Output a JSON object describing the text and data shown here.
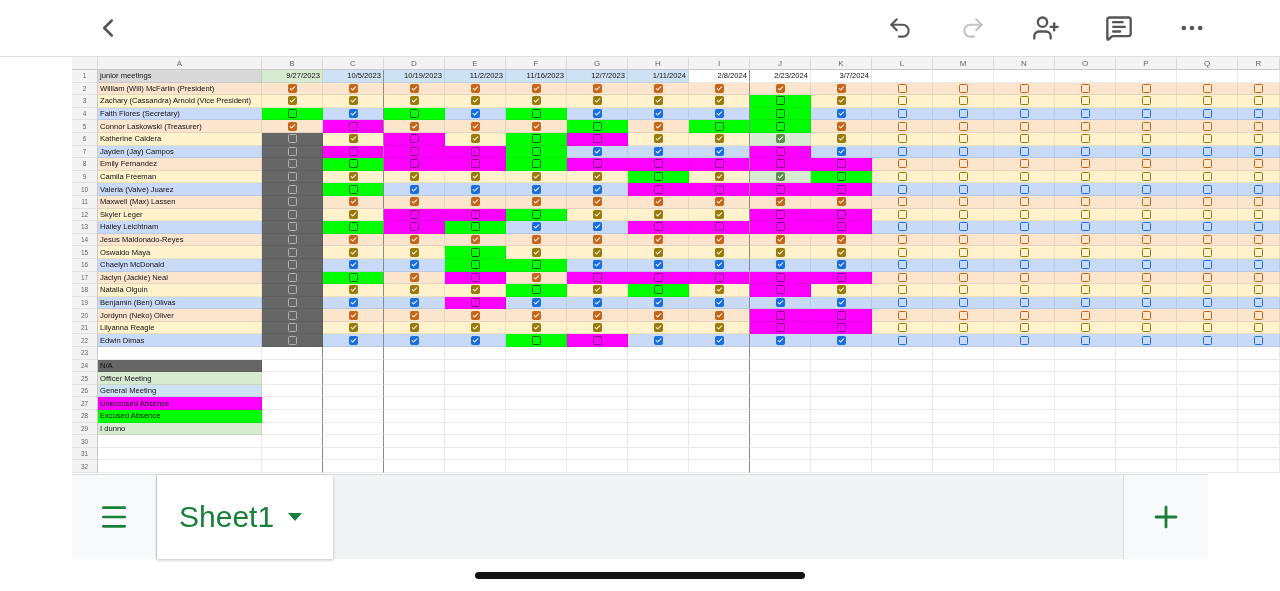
{
  "toolbar": {
    "redo": {
      "disabled": true
    }
  },
  "columns": [
    "A",
    "B",
    "C",
    "D",
    "E",
    "F",
    "G",
    "H",
    "I",
    "J",
    "K",
    "L",
    "M",
    "N",
    "O",
    "P",
    "Q",
    "R"
  ],
  "header_row": {
    "number": "1",
    "title": "junior meetings",
    "dates": [
      {
        "label": "9/27/2023",
        "color": "#d9ead3"
      },
      {
        "label": "10/5/2023",
        "color": "#cfe2f3"
      },
      {
        "label": "10/19/2023",
        "color": "#cfe2f3"
      },
      {
        "label": "11/2/2023",
        "color": "#cfe2f3"
      },
      {
        "label": "11/16/2023",
        "color": "#cfe2f3"
      },
      {
        "label": "12/7/2023",
        "color": "#cfe2f3"
      },
      {
        "label": "1/11/2024",
        "color": "#cfe2f3"
      },
      {
        "label": "2/8/2024"
      },
      {
        "label": "2/23/2024"
      },
      {
        "label": "3/7/2024"
      }
    ]
  },
  "rows": [
    {
      "number": "2",
      "name": "William (Will) McFarlin (President)",
      "cells": [
        {
          "checked": true
        },
        {
          "checked": true
        },
        {
          "checked": true
        },
        {
          "checked": true
        },
        {
          "checked": true
        },
        {
          "checked": true
        },
        {
          "checked": true
        },
        {
          "checked": true
        },
        {
          "checked": true
        },
        {
          "checked": true
        },
        {
          "checked": false
        },
        {
          "checked": false
        },
        {
          "checked": false
        },
        {
          "checked": false
        },
        {
          "checked": false
        },
        {
          "checked": false
        },
        {
          "checked": false
        }
      ]
    },
    {
      "number": "3",
      "name": "Zachary (Cassandra) Arnold (Vice President)",
      "cells": [
        {
          "checked": true
        },
        {
          "checked": true
        },
        {
          "checked": true
        },
        {
          "checked": true
        },
        {
          "checked": true
        },
        {
          "checked": true
        },
        {
          "checked": true
        },
        {
          "checked": true
        },
        {
          "checked": false,
          "color": "#00ff00"
        },
        {
          "checked": true
        },
        {
          "checked": false
        },
        {
          "checked": false
        },
        {
          "checked": false
        },
        {
          "checked": false
        },
        {
          "checked": false
        },
        {
          "checked": false
        },
        {
          "checked": false
        }
      ]
    },
    {
      "number": "4",
      "name": "Faith Flores (Secretary)",
      "cells": [
        {
          "checked": false,
          "color": "#00ff00"
        },
        {
          "checked": true
        },
        {
          "checked": false,
          "color": "#00ff00"
        },
        {
          "checked": true
        },
        {
          "checked": false,
          "color": "#00ff00"
        },
        {
          "checked": true
        },
        {
          "checked": true
        },
        {
          "checked": true
        },
        {
          "checked": false,
          "color": "#00ff00"
        },
        {
          "checked": true
        },
        {
          "checked": false
        },
        {
          "checked": false
        },
        {
          "checked": false
        },
        {
          "checked": false
        },
        {
          "checked": false
        },
        {
          "checked": false
        },
        {
          "checked": false
        }
      ]
    },
    {
      "number": "5",
      "name": "Connor Laskowski (Treasurer)",
      "cells": [
        {
          "checked": true
        },
        {
          "checked": false,
          "color": "#ff00ff"
        },
        {
          "checked": true
        },
        {
          "checked": true
        },
        {
          "checked": true
        },
        {
          "checked": false,
          "color": "#00ff00"
        },
        {
          "checked": true
        },
        {
          "checked": false,
          "color": "#00ff00"
        },
        {
          "checked": false,
          "color": "#00ff00"
        },
        {
          "checked": true
        },
        {
          "checked": false
        },
        {
          "checked": false
        },
        {
          "checked": false
        },
        {
          "checked": false
        },
        {
          "checked": false
        },
        {
          "checked": false
        },
        {
          "checked": false
        }
      ]
    },
    {
      "number": "6",
      "name": "Katherine Caldera",
      "cells": [
        {
          "checked": false,
          "color": "#666666"
        },
        {
          "checked": true
        },
        {
          "checked": false,
          "color": "#ff00ff"
        },
        {
          "checked": true
        },
        {
          "checked": false,
          "color": "#00ff00"
        },
        {
          "checked": false,
          "color": "#ff00ff"
        },
        {
          "checked": true
        },
        {
          "checked": true
        },
        {
          "checked": true,
          "color": "#d9ead3"
        },
        {
          "checked": true
        },
        {
          "checked": false
        },
        {
          "checked": false
        },
        {
          "checked": false
        },
        {
          "checked": false
        },
        {
          "checked": false
        },
        {
          "checked": false
        },
        {
          "checked": false
        }
      ]
    },
    {
      "number": "7",
      "name": "Jayden (Jay) Campos",
      "cells": [
        {
          "checked": false,
          "color": "#666666"
        },
        {
          "checked": false,
          "color": "#ff00ff"
        },
        {
          "checked": false,
          "color": "#ff00ff"
        },
        {
          "checked": false,
          "color": "#ff00ff"
        },
        {
          "checked": false,
          "color": "#00ff00"
        },
        {
          "checked": true
        },
        {
          "checked": true
        },
        {
          "checked": true
        },
        {
          "checked": false,
          "color": "#ff00ff"
        },
        {
          "checked": true
        },
        {
          "checked": false
        },
        {
          "checked": false
        },
        {
          "checked": false
        },
        {
          "checked": false
        },
        {
          "checked": false
        },
        {
          "checked": false
        },
        {
          "checked": false
        }
      ]
    },
    {
      "number": "8",
      "name": "Emily Fernandez",
      "cells": [
        {
          "checked": false,
          "color": "#666666"
        },
        {
          "checked": false,
          "color": "#00ff00"
        },
        {
          "checked": false,
          "color": "#ff00ff"
        },
        {
          "checked": false,
          "color": "#ff00ff"
        },
        {
          "checked": false,
          "color": "#00ff00"
        },
        {
          "checked": false,
          "color": "#ff00ff"
        },
        {
          "checked": false,
          "color": "#ff00ff"
        },
        {
          "checked": false,
          "color": "#ff00ff"
        },
        {
          "checked": false,
          "color": "#ff00ff"
        },
        {
          "checked": false,
          "color": "#ff00ff"
        },
        {
          "checked": false
        },
        {
          "checked": false
        },
        {
          "checked": false
        },
        {
          "checked": false
        },
        {
          "checked": false
        },
        {
          "checked": false
        },
        {
          "checked": false
        }
      ]
    },
    {
      "number": "9",
      "name": "Camila Freeman",
      "cells": [
        {
          "checked": false,
          "color": "#666666"
        },
        {
          "checked": true
        },
        {
          "checked": true
        },
        {
          "checked": true
        },
        {
          "checked": true
        },
        {
          "checked": true
        },
        {
          "checked": false,
          "color": "#00ff00"
        },
        {
          "checked": true
        },
        {
          "checked": true,
          "color": "#d9ead3"
        },
        {
          "checked": false,
          "color": "#00ff00"
        },
        {
          "checked": false
        },
        {
          "checked": false
        },
        {
          "checked": false
        },
        {
          "checked": false
        },
        {
          "checked": false
        },
        {
          "checked": false
        },
        {
          "checked": false
        }
      ]
    },
    {
      "number": "10",
      "name": "Valeria (Valve) Juarez",
      "cells": [
        {
          "checked": false,
          "color": "#666666"
        },
        {
          "checked": false,
          "color": "#00ff00"
        },
        {
          "checked": true
        },
        {
          "checked": true
        },
        {
          "checked": true
        },
        {
          "checked": true
        },
        {
          "checked": false,
          "color": "#ff00ff"
        },
        {
          "checked": false,
          "color": "#ff00ff"
        },
        {
          "checked": false,
          "color": "#ff00ff"
        },
        {
          "checked": false,
          "color": "#ff00ff"
        },
        {
          "checked": false
        },
        {
          "checked": false
        },
        {
          "checked": false
        },
        {
          "checked": false
        },
        {
          "checked": false
        },
        {
          "checked": false
        },
        {
          "checked": false
        }
      ]
    },
    {
      "number": "11",
      "name": "Maxwell (Max) Lassen",
      "cells": [
        {
          "checked": false,
          "color": "#666666"
        },
        {
          "checked": true
        },
        {
          "checked": true
        },
        {
          "checked": true
        },
        {
          "checked": true
        },
        {
          "checked": true
        },
        {
          "checked": true
        },
        {
          "checked": true
        },
        {
          "checked": true
        },
        {
          "checked": true
        },
        {
          "checked": false
        },
        {
          "checked": false
        },
        {
          "checked": false
        },
        {
          "checked": false
        },
        {
          "checked": false
        },
        {
          "checked": false
        },
        {
          "checked": false
        }
      ]
    },
    {
      "number": "12",
      "name": "Skyler Leger",
      "cells": [
        {
          "checked": false,
          "color": "#666666"
        },
        {
          "checked": true
        },
        {
          "checked": false,
          "color": "#ff00ff"
        },
        {
          "checked": false,
          "color": "#ff00ff"
        },
        {
          "checked": false,
          "color": "#00ff00"
        },
        {
          "checked": true
        },
        {
          "checked": true
        },
        {
          "checked": true
        },
        {
          "checked": false,
          "color": "#ff00ff"
        },
        {
          "checked": false,
          "color": "#ff00ff"
        },
        {
          "checked": false
        },
        {
          "checked": false
        },
        {
          "checked": false
        },
        {
          "checked": false
        },
        {
          "checked": false
        },
        {
          "checked": false
        },
        {
          "checked": false
        }
      ]
    },
    {
      "number": "13",
      "name": "Hailey Leichtnam",
      "cells": [
        {
          "checked": false,
          "color": "#666666"
        },
        {
          "checked": false,
          "color": "#00ff00"
        },
        {
          "checked": false,
          "color": "#ff00ff"
        },
        {
          "checked": false,
          "color": "#00ff00"
        },
        {
          "checked": true
        },
        {
          "checked": true
        },
        {
          "checked": false,
          "color": "#ff00ff"
        },
        {
          "checked": false,
          "color": "#ff00ff"
        },
        {
          "checked": false,
          "color": "#ff00ff"
        },
        {
          "checked": false,
          "color": "#ff00ff"
        },
        {
          "checked": false
        },
        {
          "checked": false
        },
        {
          "checked": false
        },
        {
          "checked": false
        },
        {
          "checked": false
        },
        {
          "checked": false
        },
        {
          "checked": false
        }
      ]
    },
    {
      "number": "14",
      "name": "Jesus Maldonado-Reyes",
      "cells": [
        {
          "checked": false,
          "color": "#666666"
        },
        {
          "checked": true
        },
        {
          "checked": true
        },
        {
          "checked": true
        },
        {
          "checked": true
        },
        {
          "checked": true
        },
        {
          "checked": true
        },
        {
          "checked": true
        },
        {
          "checked": true
        },
        {
          "checked": true
        },
        {
          "checked": false
        },
        {
          "checked": false
        },
        {
          "checked": false
        },
        {
          "checked": false
        },
        {
          "checked": false
        },
        {
          "checked": false
        },
        {
          "checked": false
        }
      ]
    },
    {
      "number": "15",
      "name": "Oswaldo Maya",
      "cells": [
        {
          "checked": false,
          "color": "#666666"
        },
        {
          "checked": true
        },
        {
          "checked": true
        },
        {
          "checked": false,
          "color": "#00ff00"
        },
        {
          "checked": true
        },
        {
          "checked": true
        },
        {
          "checked": true
        },
        {
          "checked": true
        },
        {
          "checked": true
        },
        {
          "checked": true
        },
        {
          "checked": false
        },
        {
          "checked": false
        },
        {
          "checked": false
        },
        {
          "checked": false
        },
        {
          "checked": false
        },
        {
          "checked": false
        },
        {
          "checked": false
        }
      ]
    },
    {
      "number": "16",
      "name": "Chaelyn McDonald",
      "cells": [
        {
          "checked": false,
          "color": "#666666"
        },
        {
          "checked": true
        },
        {
          "checked": true
        },
        {
          "checked": false,
          "color": "#00ff00"
        },
        {
          "checked": false,
          "color": "#00ff00"
        },
        {
          "checked": true
        },
        {
          "checked": true
        },
        {
          "checked": true
        },
        {
          "checked": true
        },
        {
          "checked": true
        },
        {
          "checked": false
        },
        {
          "checked": false
        },
        {
          "checked": false
        },
        {
          "checked": false
        },
        {
          "checked": false
        },
        {
          "checked": false
        },
        {
          "checked": false
        }
      ]
    },
    {
      "number": "17",
      "name": "Jaclyn (Jackie) Neal",
      "cells": [
        {
          "checked": false,
          "color": "#666666"
        },
        {
          "checked": false,
          "color": "#00ff00"
        },
        {
          "checked": true
        },
        {
          "checked": false,
          "color": "#ff00ff"
        },
        {
          "checked": true
        },
        {
          "checked": false,
          "color": "#ff00ff"
        },
        {
          "checked": false,
          "color": "#ff00ff"
        },
        {
          "checked": false,
          "color": "#ff00ff"
        },
        {
          "checked": false,
          "color": "#ff00ff"
        },
        {
          "checked": false,
          "color": "#ff00ff"
        },
        {
          "checked": false
        },
        {
          "checked": false
        },
        {
          "checked": false
        },
        {
          "checked": false
        },
        {
          "checked": false
        },
        {
          "checked": false
        },
        {
          "checked": false
        }
      ]
    },
    {
      "number": "18",
      "name": "Natalia Olguin",
      "cells": [
        {
          "checked": false,
          "color": "#666666"
        },
        {
          "checked": true
        },
        {
          "checked": true
        },
        {
          "checked": true
        },
        {
          "checked": false,
          "color": "#00ff00"
        },
        {
          "checked": true
        },
        {
          "checked": false,
          "color": "#00ff00"
        },
        {
          "checked": true
        },
        {
          "checked": false,
          "color": "#ff00ff"
        },
        {
          "checked": true
        },
        {
          "checked": false
        },
        {
          "checked": false
        },
        {
          "checked": false
        },
        {
          "checked": false
        },
        {
          "checked": false
        },
        {
          "checked": false
        },
        {
          "checked": false
        }
      ]
    },
    {
      "number": "19",
      "name": "Benjamin (Ben) Olivas",
      "cells": [
        {
          "checked": false,
          "color": "#666666"
        },
        {
          "checked": true
        },
        {
          "checked": true
        },
        {
          "checked": false,
          "color": "#ff00ff"
        },
        {
          "checked": true
        },
        {
          "checked": true
        },
        {
          "checked": true
        },
        {
          "checked": true
        },
        {
          "checked": true
        },
        {
          "checked": true
        },
        {
          "checked": false
        },
        {
          "checked": false
        },
        {
          "checked": false
        },
        {
          "checked": false
        },
        {
          "checked": false
        },
        {
          "checked": false
        },
        {
          "checked": false
        }
      ]
    },
    {
      "number": "20",
      "name": "Jordynn (Neko) Oliver",
      "cells": [
        {
          "checked": false,
          "color": "#666666"
        },
        {
          "checked": true
        },
        {
          "checked": true
        },
        {
          "checked": true
        },
        {
          "checked": true
        },
        {
          "checked": true
        },
        {
          "checked": true
        },
        {
          "checked": true
        },
        {
          "checked": false,
          "color": "#ff00ff"
        },
        {
          "checked": false,
          "color": "#ff00ff"
        },
        {
          "checked": false
        },
        {
          "checked": false
        },
        {
          "checked": false
        },
        {
          "checked": false
        },
        {
          "checked": false
        },
        {
          "checked": false
        },
        {
          "checked": false
        }
      ]
    },
    {
      "number": "21",
      "name": "Lilyanna Reagle",
      "cells": [
        {
          "checked": false,
          "color": "#666666"
        },
        {
          "checked": true
        },
        {
          "checked": true
        },
        {
          "checked": true
        },
        {
          "checked": true
        },
        {
          "checked": true
        },
        {
          "checked": true
        },
        {
          "checked": true
        },
        {
          "checked": false,
          "color": "#ff00ff"
        },
        {
          "checked": false,
          "color": "#ff00ff"
        },
        {
          "checked": false
        },
        {
          "checked": false
        },
        {
          "checked": false
        },
        {
          "checked": false
        },
        {
          "checked": false
        },
        {
          "checked": false
        },
        {
          "checked": false
        }
      ]
    },
    {
      "number": "22",
      "name": "Edwin Dimas",
      "cells": [
        {
          "checked": false,
          "color": "#666666"
        },
        {
          "checked": true
        },
        {
          "checked": true
        },
        {
          "checked": true
        },
        {
          "checked": false,
          "color": "#00ff00"
        },
        {
          "checked": false,
          "color": "#ff00ff"
        },
        {
          "checked": true
        },
        {
          "checked": true
        },
        {
          "checked": true
        },
        {
          "checked": true
        },
        {
          "checked": false
        },
        {
          "checked": false
        },
        {
          "checked": false
        },
        {
          "checked": false
        },
        {
          "checked": false
        },
        {
          "checked": false
        },
        {
          "checked": false
        }
      ]
    }
  ],
  "lower_rows": [
    {
      "number": "23"
    },
    {
      "number": "24",
      "label": "N/A",
      "color": "#666666"
    },
    {
      "number": "25",
      "label": "Officer Meeting",
      "color": "#d9ead3"
    },
    {
      "number": "26",
      "label": "General Meeting",
      "color": "#cfe2f3"
    },
    {
      "number": "27",
      "label": "Unexcused Absence",
      "color": "#ff00ff"
    },
    {
      "number": "28",
      "label": "Excused Absence",
      "color": "#00ff00"
    },
    {
      "number": "29",
      "label": "I dunno",
      "color": "#d9ead3"
    },
    {
      "number": "30"
    },
    {
      "number": "31"
    },
    {
      "number": "32"
    }
  ],
  "sheet_tabs": [
    {
      "label": "Sheet1",
      "selected": true
    }
  ]
}
